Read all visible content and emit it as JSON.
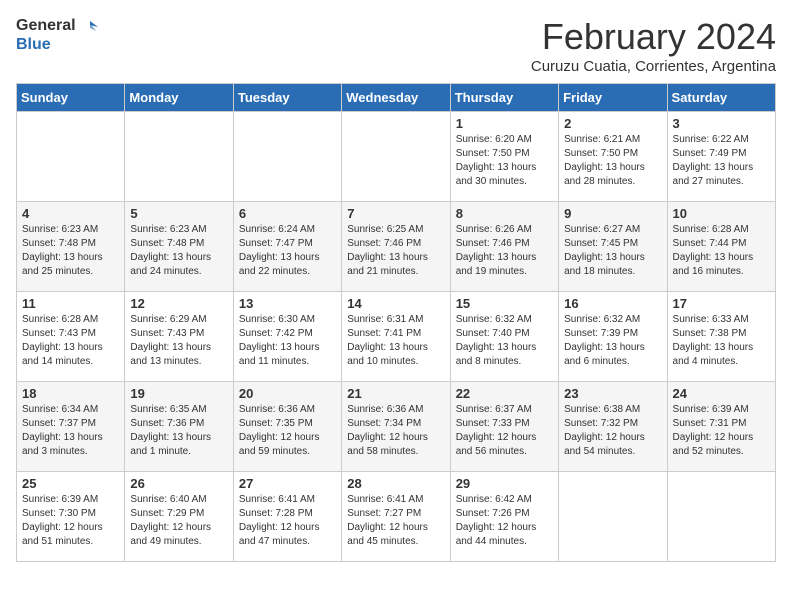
{
  "header": {
    "logo_line1": "General",
    "logo_line2": "Blue",
    "main_title": "February 2024",
    "subtitle": "Curuzu Cuatia, Corrientes, Argentina"
  },
  "weekdays": [
    "Sunday",
    "Monday",
    "Tuesday",
    "Wednesday",
    "Thursday",
    "Friday",
    "Saturday"
  ],
  "weeks": [
    [
      {
        "day": "",
        "info": ""
      },
      {
        "day": "",
        "info": ""
      },
      {
        "day": "",
        "info": ""
      },
      {
        "day": "",
        "info": ""
      },
      {
        "day": "1",
        "info": "Sunrise: 6:20 AM\nSunset: 7:50 PM\nDaylight: 13 hours and 30 minutes."
      },
      {
        "day": "2",
        "info": "Sunrise: 6:21 AM\nSunset: 7:50 PM\nDaylight: 13 hours and 28 minutes."
      },
      {
        "day": "3",
        "info": "Sunrise: 6:22 AM\nSunset: 7:49 PM\nDaylight: 13 hours and 27 minutes."
      }
    ],
    [
      {
        "day": "4",
        "info": "Sunrise: 6:23 AM\nSunset: 7:48 PM\nDaylight: 13 hours and 25 minutes."
      },
      {
        "day": "5",
        "info": "Sunrise: 6:23 AM\nSunset: 7:48 PM\nDaylight: 13 hours and 24 minutes."
      },
      {
        "day": "6",
        "info": "Sunrise: 6:24 AM\nSunset: 7:47 PM\nDaylight: 13 hours and 22 minutes."
      },
      {
        "day": "7",
        "info": "Sunrise: 6:25 AM\nSunset: 7:46 PM\nDaylight: 13 hours and 21 minutes."
      },
      {
        "day": "8",
        "info": "Sunrise: 6:26 AM\nSunset: 7:46 PM\nDaylight: 13 hours and 19 minutes."
      },
      {
        "day": "9",
        "info": "Sunrise: 6:27 AM\nSunset: 7:45 PM\nDaylight: 13 hours and 18 minutes."
      },
      {
        "day": "10",
        "info": "Sunrise: 6:28 AM\nSunset: 7:44 PM\nDaylight: 13 hours and 16 minutes."
      }
    ],
    [
      {
        "day": "11",
        "info": "Sunrise: 6:28 AM\nSunset: 7:43 PM\nDaylight: 13 hours and 14 minutes."
      },
      {
        "day": "12",
        "info": "Sunrise: 6:29 AM\nSunset: 7:43 PM\nDaylight: 13 hours and 13 minutes."
      },
      {
        "day": "13",
        "info": "Sunrise: 6:30 AM\nSunset: 7:42 PM\nDaylight: 13 hours and 11 minutes."
      },
      {
        "day": "14",
        "info": "Sunrise: 6:31 AM\nSunset: 7:41 PM\nDaylight: 13 hours and 10 minutes."
      },
      {
        "day": "15",
        "info": "Sunrise: 6:32 AM\nSunset: 7:40 PM\nDaylight: 13 hours and 8 minutes."
      },
      {
        "day": "16",
        "info": "Sunrise: 6:32 AM\nSunset: 7:39 PM\nDaylight: 13 hours and 6 minutes."
      },
      {
        "day": "17",
        "info": "Sunrise: 6:33 AM\nSunset: 7:38 PM\nDaylight: 13 hours and 4 minutes."
      }
    ],
    [
      {
        "day": "18",
        "info": "Sunrise: 6:34 AM\nSunset: 7:37 PM\nDaylight: 13 hours and 3 minutes."
      },
      {
        "day": "19",
        "info": "Sunrise: 6:35 AM\nSunset: 7:36 PM\nDaylight: 13 hours and 1 minute."
      },
      {
        "day": "20",
        "info": "Sunrise: 6:36 AM\nSunset: 7:35 PM\nDaylight: 12 hours and 59 minutes."
      },
      {
        "day": "21",
        "info": "Sunrise: 6:36 AM\nSunset: 7:34 PM\nDaylight: 12 hours and 58 minutes."
      },
      {
        "day": "22",
        "info": "Sunrise: 6:37 AM\nSunset: 7:33 PM\nDaylight: 12 hours and 56 minutes."
      },
      {
        "day": "23",
        "info": "Sunrise: 6:38 AM\nSunset: 7:32 PM\nDaylight: 12 hours and 54 minutes."
      },
      {
        "day": "24",
        "info": "Sunrise: 6:39 AM\nSunset: 7:31 PM\nDaylight: 12 hours and 52 minutes."
      }
    ],
    [
      {
        "day": "25",
        "info": "Sunrise: 6:39 AM\nSunset: 7:30 PM\nDaylight: 12 hours and 51 minutes."
      },
      {
        "day": "26",
        "info": "Sunrise: 6:40 AM\nSunset: 7:29 PM\nDaylight: 12 hours and 49 minutes."
      },
      {
        "day": "27",
        "info": "Sunrise: 6:41 AM\nSunset: 7:28 PM\nDaylight: 12 hours and 47 minutes."
      },
      {
        "day": "28",
        "info": "Sunrise: 6:41 AM\nSunset: 7:27 PM\nDaylight: 12 hours and 45 minutes."
      },
      {
        "day": "29",
        "info": "Sunrise: 6:42 AM\nSunset: 7:26 PM\nDaylight: 12 hours and 44 minutes."
      },
      {
        "day": "",
        "info": ""
      },
      {
        "day": "",
        "info": ""
      }
    ]
  ]
}
